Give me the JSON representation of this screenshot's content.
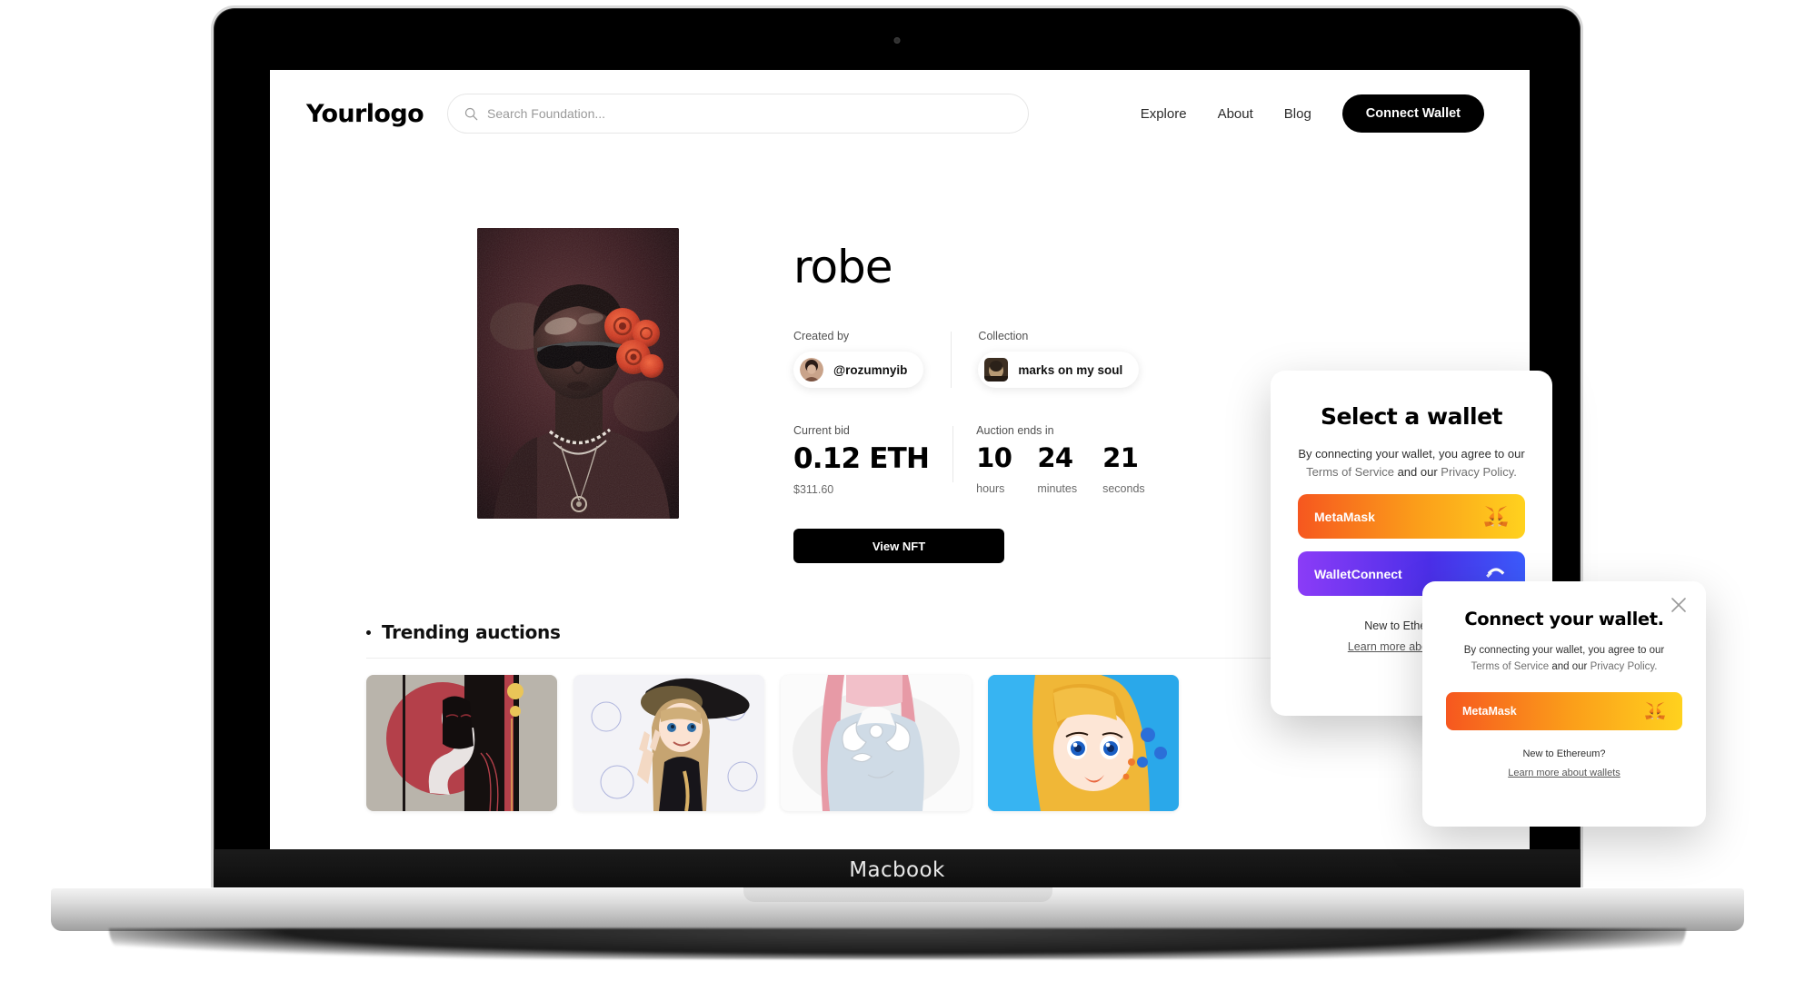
{
  "device": {
    "label": "Macbook"
  },
  "header": {
    "logo": "Yourlogo",
    "search": {
      "placeholder": "Search Foundation...",
      "value": "",
      "icon": "search-icon"
    },
    "nav": [
      {
        "label": "Explore"
      },
      {
        "label": "About"
      },
      {
        "label": "Blog"
      }
    ],
    "connect_button": "Connect Wallet"
  },
  "hero": {
    "artwork_alt": "robe",
    "title": "robe",
    "created_by": {
      "label": "Created by",
      "handle": "@rozumnyib"
    },
    "collection": {
      "label": "Collection",
      "name": "marks on my soul"
    },
    "current_bid": {
      "label": "Current bid",
      "value": "0.12 ETH",
      "usd": "$311.60"
    },
    "auction": {
      "label": "Auction ends in",
      "units": [
        {
          "value": "10",
          "label": "hours"
        },
        {
          "value": "24",
          "label": "minutes"
        },
        {
          "value": "21",
          "label": "seconds"
        }
      ]
    },
    "view_button": "View NFT"
  },
  "trending": {
    "title": "Trending auctions",
    "cards": [
      {
        "alt": "red-moon-figure-artwork"
      },
      {
        "alt": "witch-hat-girl-artwork"
      },
      {
        "alt": "pink-hair-sweater-artwork"
      },
      {
        "alt": "blue-eyes-blonde-artwork"
      }
    ]
  },
  "wallet_modal": {
    "title": "Select a wallet",
    "consent_line1": "By connecting your wallet, you agree to our",
    "terms": "Terms of Service",
    "and_our": " and our ",
    "privacy": "Privacy Policy.",
    "wallets": [
      {
        "name": "MetaMask",
        "icon": "metamask-fox-icon"
      },
      {
        "name": "WalletConnect",
        "icon": "walletconnect-icon"
      }
    ],
    "footnote_title": "New to Ethereum?",
    "footnote_link": "Learn more about wallets"
  },
  "connect_modal": {
    "title": "Connect your wallet.",
    "consent_line1": "By connecting your wallet, you agree to our",
    "terms": "Terms of Service",
    "and_our": " and our ",
    "privacy": "Privacy Policy.",
    "wallets": [
      {
        "name": "MetaMask",
        "icon": "metamask-fox-icon"
      }
    ],
    "footnote_title": "New to Ethereum?",
    "footnote_link": "Learn more about wallets",
    "close_icon": "close-icon"
  },
  "colors": {
    "accent_black": "#000000",
    "metamask_from": "#f6571f",
    "metamask_to": "#ffd21e",
    "walletconnect_from": "#8b3cf7",
    "walletconnect_to": "#3b5bfc",
    "page_bg": "#ffffff"
  }
}
